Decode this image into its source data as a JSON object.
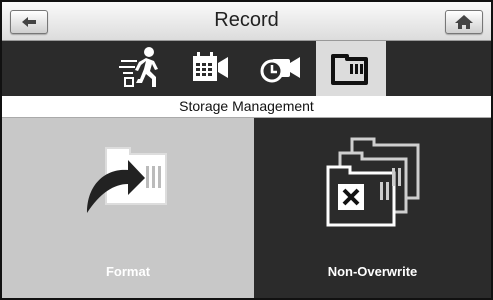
{
  "header": {
    "title": "Record"
  },
  "toolbar": {
    "back_icon": "back-arrow-icon",
    "home_icon": "home-icon"
  },
  "tabs": [
    {
      "icon": "running-person-icon",
      "active": false
    },
    {
      "icon": "calendar-camera-icon",
      "active": false
    },
    {
      "icon": "clock-camera-icon",
      "active": false
    },
    {
      "icon": "sd-card-icon",
      "active": true
    }
  ],
  "section": {
    "title": "Storage Management"
  },
  "options": {
    "format": {
      "label": "Format",
      "icon": "sd-card-format-icon"
    },
    "non_overwrite": {
      "label": "Non-Overwrite",
      "icon": "sd-card-no-overwrite-icon"
    }
  },
  "colors": {
    "dark_background": "#2b2b2b",
    "light_panel": "#c8c8c8",
    "active_tab": "#dcdcdc"
  }
}
